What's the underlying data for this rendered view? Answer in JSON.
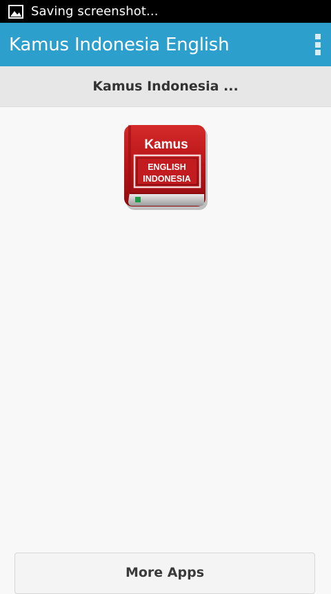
{
  "status_bar": {
    "notification_icon": "image-icon",
    "text": "Saving screenshot..."
  },
  "action_bar": {
    "title": "Kamus Indonesia English",
    "overflow_icon": "overflow-menu-icon"
  },
  "section": {
    "title": "Kamus Indonesia ..."
  },
  "app_icon": {
    "line1": "Kamus",
    "line2": "ENGLISH",
    "line3": "INDONESIA"
  },
  "footer": {
    "more_apps_label": "More Apps"
  },
  "colors": {
    "status_bar": "#000000",
    "action_bar": "#2d9fcd",
    "section_header": "#e7e7e7",
    "background": "#f8f8f8",
    "book_red": "#c4161c"
  }
}
